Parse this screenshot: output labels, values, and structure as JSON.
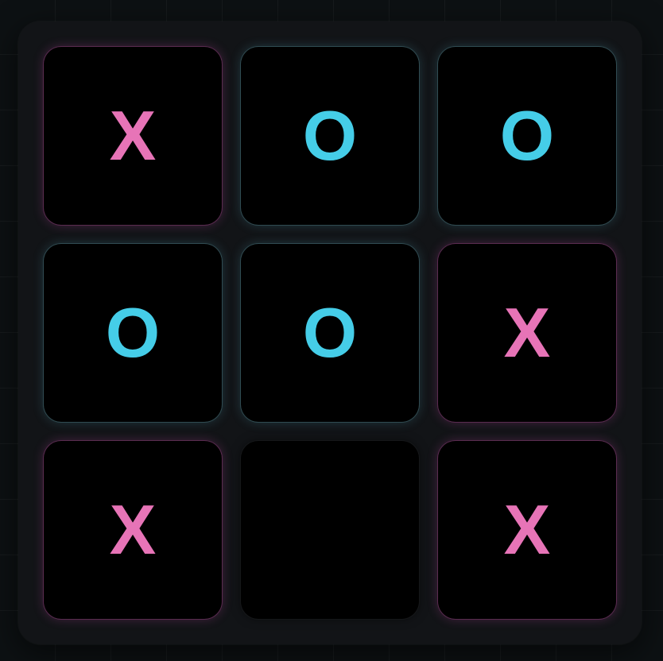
{
  "board": {
    "cells": [
      {
        "mark": "X"
      },
      {
        "mark": "O"
      },
      {
        "mark": "O"
      },
      {
        "mark": "O"
      },
      {
        "mark": "O"
      },
      {
        "mark": "X"
      },
      {
        "mark": "X"
      },
      {
        "mark": ""
      },
      {
        "mark": "X"
      }
    ]
  },
  "colors": {
    "x": "#e774b7",
    "o": "#45cde8",
    "cell_background": "#000000",
    "board_background": "#121417",
    "page_background": "#0d1113"
  }
}
